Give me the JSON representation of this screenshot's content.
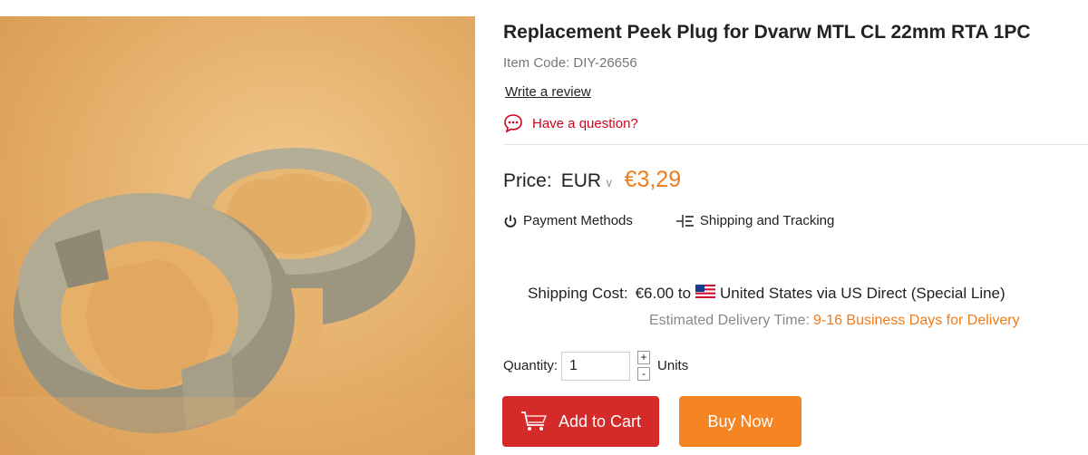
{
  "product": {
    "title": "Replacement Peek Plug for Dvarw MTL CL 22mm RTA 1PC",
    "item_code_label": "Item Code:",
    "item_code": "DIY-26656",
    "write_review": "Write a review",
    "question": "Have a question?"
  },
  "price": {
    "label": "Price:",
    "currency": "EUR",
    "value": "€3,29"
  },
  "links": {
    "payment": "Payment Methods",
    "shipping": "Shipping and Tracking"
  },
  "shipping": {
    "label": "Shipping Cost:",
    "cost": "€6.00 to",
    "destination": "United States via US Direct (Special Line)",
    "delivery_label": "Estimated Delivery Time:",
    "delivery_days": "9-16 Business Days for Delivery"
  },
  "quantity": {
    "label": "Quantity:",
    "value": "1",
    "plus": "+",
    "minus": "-",
    "units": "Units"
  },
  "buttons": {
    "add_to_cart": "Add to Cart",
    "buy_now": "Buy Now"
  },
  "colors": {
    "price": "#f07b1a",
    "add_to_cart": "#d42a2a",
    "buy_now": "#f48522",
    "question": "#d0021b"
  },
  "icons": [
    "chat-bubble-icon",
    "power-icon",
    "shipping-list-icon",
    "us-flag-icon",
    "cart-icon",
    "chevron-down-icon"
  ]
}
